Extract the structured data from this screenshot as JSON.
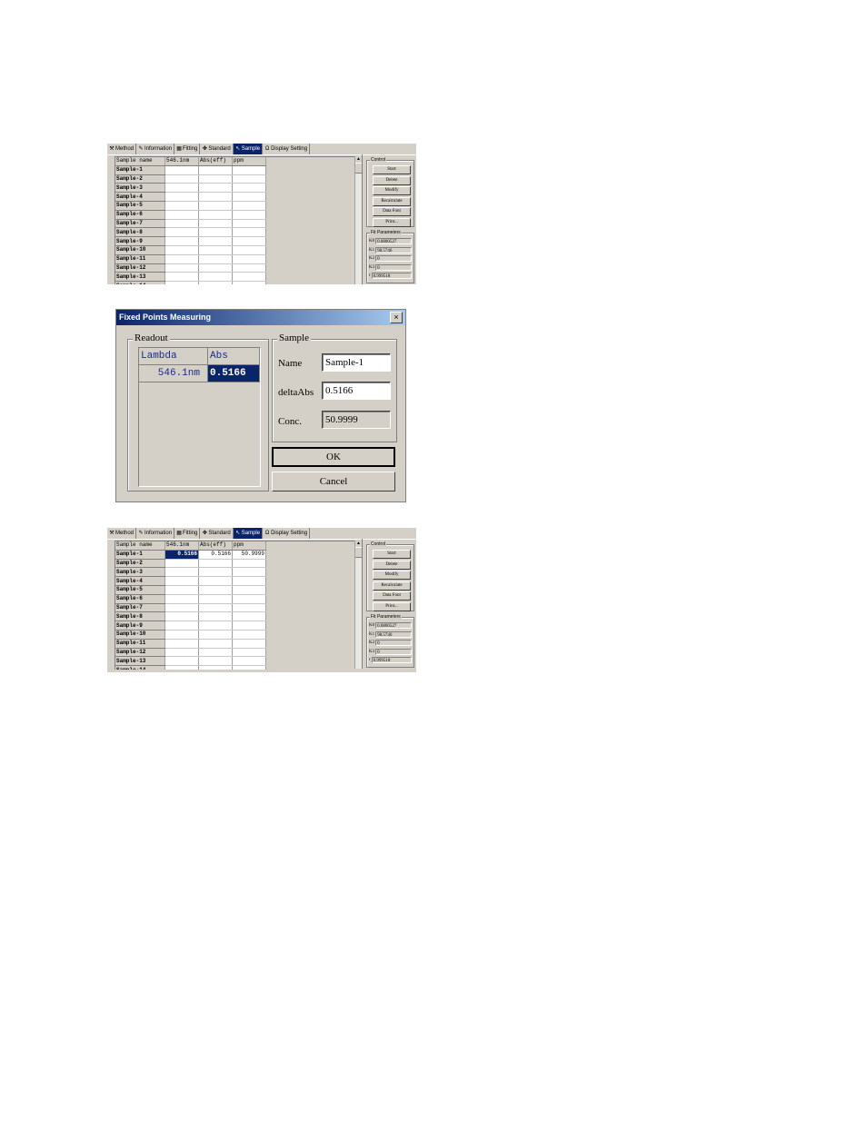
{
  "tabs": [
    {
      "label": "Method",
      "icon": "wrench-icon",
      "glyph": "⚒"
    },
    {
      "label": "Information",
      "icon": "info-icon",
      "glyph": "✎"
    },
    {
      "label": "Fitting",
      "icon": "chart-icon",
      "glyph": "▦"
    },
    {
      "label": "Standard",
      "icon": "flask-icon",
      "glyph": "✤"
    },
    {
      "label": "Sample",
      "icon": "sample-icon",
      "glyph": "↖"
    },
    {
      "label": "Display Setting",
      "icon": "omega-icon",
      "glyph": "Ω"
    }
  ],
  "grid_headers": [
    "Sample name",
    "546.1nm",
    "Abs(eff)",
    "ppm"
  ],
  "grid_before": {
    "rows": [
      [
        "Sample-1",
        "",
        "",
        ""
      ],
      [
        "Sample-2",
        "",
        "",
        ""
      ],
      [
        "Sample-3",
        "",
        "",
        ""
      ],
      [
        "Sample-4",
        "",
        "",
        ""
      ],
      [
        "Sample-5",
        "",
        "",
        ""
      ],
      [
        "Sample-6",
        "",
        "",
        ""
      ],
      [
        "Sample-7",
        "",
        "",
        ""
      ],
      [
        "Sample-8",
        "",
        "",
        ""
      ],
      [
        "Sample-9",
        "",
        "",
        ""
      ],
      [
        "Sample-10",
        "",
        "",
        ""
      ],
      [
        "Sample-11",
        "",
        "",
        ""
      ],
      [
        "Sample-12",
        "",
        "",
        ""
      ],
      [
        "Sample-13",
        "",
        "",
        ""
      ],
      [
        "Sample-14",
        "",
        "",
        ""
      ]
    ]
  },
  "grid_after": {
    "rows": [
      [
        "Sample-1",
        "0.5166",
        "0.5166",
        "50.9999"
      ],
      [
        "Sample-2",
        "",
        "",
        ""
      ],
      [
        "Sample-3",
        "",
        "",
        ""
      ],
      [
        "Sample-4",
        "",
        "",
        ""
      ],
      [
        "Sample-5",
        "",
        "",
        ""
      ],
      [
        "Sample-6",
        "",
        "",
        ""
      ],
      [
        "Sample-7",
        "",
        "",
        ""
      ],
      [
        "Sample-8",
        "",
        "",
        ""
      ],
      [
        "Sample-9",
        "",
        "",
        ""
      ],
      [
        "Sample-10",
        "",
        "",
        ""
      ],
      [
        "Sample-11",
        "",
        "",
        ""
      ],
      [
        "Sample-12",
        "",
        "",
        ""
      ],
      [
        "Sample-13",
        "",
        "",
        ""
      ],
      [
        "Sample-14",
        "",
        "",
        ""
      ]
    ]
  },
  "control": {
    "legend": "Control",
    "buttons": [
      "Start",
      "Delete",
      "Modify",
      "Recalculate",
      "Data Font",
      "Print..."
    ]
  },
  "fit": {
    "legend": "Fit Parameters",
    "params": [
      {
        "label": "K0",
        "value": "0.0800527"
      },
      {
        "label": "K1",
        "value": "98.5746"
      },
      {
        "label": "K2",
        "value": "0"
      },
      {
        "label": "K3",
        "value": "0"
      },
      {
        "label": "r",
        "value": "0.999518"
      }
    ]
  },
  "dialog": {
    "title": "Fixed Points Measuring",
    "close": "×",
    "readout": {
      "legend": "Readout",
      "headers": [
        "Lambda",
        "Abs"
      ],
      "row": [
        "546.1nm",
        "0.5166"
      ]
    },
    "sample": {
      "legend": "Sample",
      "name_label": "Name",
      "name_value": "Sample-1",
      "delta_label": "deltaAbs",
      "delta_value": "0.5166",
      "conc_label": "Conc.",
      "conc_value": "50.9999"
    },
    "ok": "OK",
    "cancel": "Cancel"
  }
}
